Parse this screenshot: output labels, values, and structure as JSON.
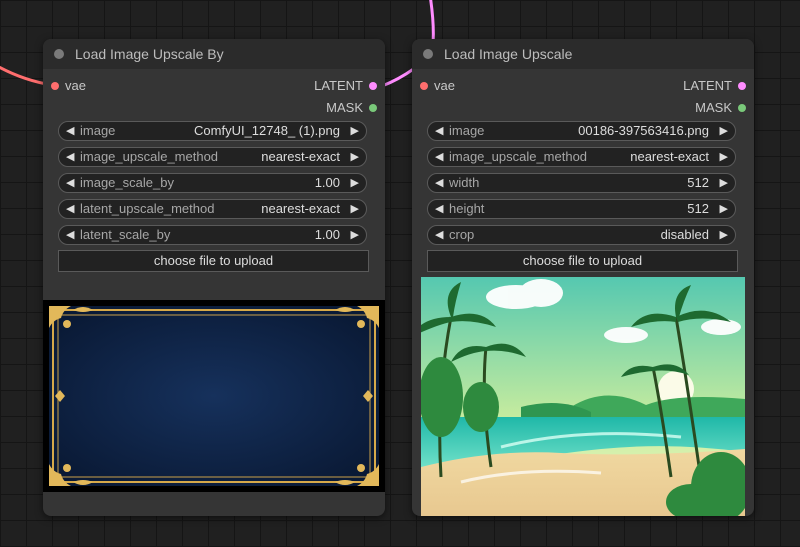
{
  "canvas": {
    "background": "#202020",
    "grid": true
  },
  "colors": {
    "vae_slot": "#ff6e6e",
    "latent_slot": "#ff8cff",
    "mask_slot": "#7ac97a",
    "link_vae": "#ff6e6e",
    "link_latent": "#ff8cff"
  },
  "nodes": [
    {
      "title": "Load Image Upscale By",
      "inputs": [
        {
          "label": "vae"
        }
      ],
      "outputs": [
        {
          "label": "LATENT"
        },
        {
          "label": "MASK"
        }
      ],
      "widgets": [
        {
          "label": "image",
          "value": "ComfyUI_12748_ (1).png"
        },
        {
          "label": "image_upscale_method",
          "value": "nearest-exact"
        },
        {
          "label": "image_scale_by",
          "value": "1.00"
        },
        {
          "label": "latent_upscale_method",
          "value": "nearest-exact"
        },
        {
          "label": "latent_scale_by",
          "value": "1.00"
        }
      ],
      "upload_label": "choose file to upload",
      "preview_icon": "ornate-gold-frame-image"
    },
    {
      "title": "Load Image Upscale",
      "inputs": [
        {
          "label": "vae"
        }
      ],
      "outputs": [
        {
          "label": "LATENT"
        },
        {
          "label": "MASK"
        }
      ],
      "widgets": [
        {
          "label": "image",
          "value": "00186-397563416.png"
        },
        {
          "label": "image_upscale_method",
          "value": "nearest-exact"
        },
        {
          "label": "width",
          "value": "512"
        },
        {
          "label": "height",
          "value": "512"
        },
        {
          "label": "crop",
          "value": "disabled"
        }
      ],
      "upload_label": "choose file to upload",
      "preview_icon": "tropical-beach-image"
    }
  ]
}
